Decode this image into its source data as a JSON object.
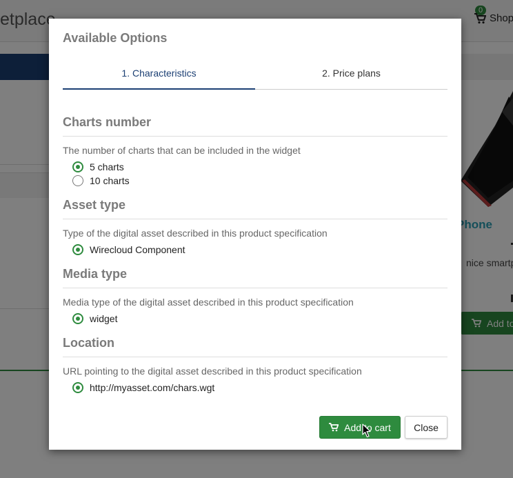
{
  "background": {
    "brand_partial": "etplace",
    "cart_label": "Shop",
    "cart_count": "0",
    "product_name_partial": "Phone",
    "product_desc_partial": "nice smartp",
    "add_label_partial": "Add to"
  },
  "modal": {
    "title": "Available Options",
    "tabs": [
      {
        "label": "1. Characteristics",
        "active": true
      },
      {
        "label": "2. Price plans",
        "active": false
      }
    ],
    "sections": [
      {
        "title": "Charts number",
        "description": "The number of charts that can be included in the widget",
        "options": [
          {
            "label": "5 charts",
            "checked": true
          },
          {
            "label": "10 charts",
            "checked": false
          }
        ]
      },
      {
        "title": "Asset type",
        "description": "Type of the digital asset described in this product specification",
        "options": [
          {
            "label": "Wirecloud Component",
            "checked": true
          }
        ]
      },
      {
        "title": "Media type",
        "description": "Media type of the digital asset described in this product specification",
        "options": [
          {
            "label": "widget",
            "checked": true
          }
        ]
      },
      {
        "title": "Location",
        "description": "URL pointing to the digital asset described in this product specification",
        "options": [
          {
            "label": "http://myasset.com/chars.wgt",
            "checked": true
          }
        ]
      }
    ],
    "buttons": {
      "add_to_cart": "Add to cart",
      "close": "Close"
    }
  },
  "icons": {
    "cart": "shopping-cart-icon",
    "radio_on": "radio-checked-icon",
    "radio_off": "radio-unchecked-icon",
    "cursor": "mouse-pointer-icon"
  },
  "colors": {
    "accent_green": "#2e8b3e",
    "tab_active": "#1b3f73",
    "product_name": "#2a9fb4",
    "overlay": "rgba(0,0,0,0.5)"
  }
}
